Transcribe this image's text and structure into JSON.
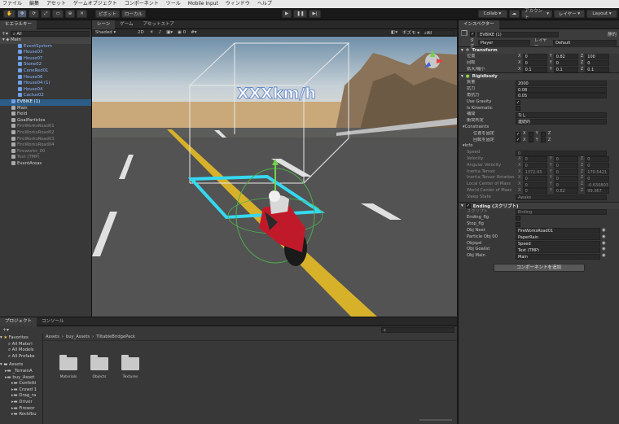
{
  "menubar": [
    "ファイル",
    "編集",
    "アセット",
    "ゲームオブジェクト",
    "コンポーネント",
    "ツール",
    "Mobile Input",
    "ウィンドウ",
    "ヘルプ"
  ],
  "toolbar": {
    "pivot": "ピボット",
    "local": "ローカル",
    "collab": "Collab",
    "account": "アカウント",
    "layers": "レイヤー",
    "layout": "Layout"
  },
  "hierarchy": {
    "tab": "ヒエラルキー",
    "search": "All",
    "root": "Main",
    "items": [
      {
        "label": "EventSystem",
        "style": "blue"
      },
      {
        "label": "House03",
        "style": "blue"
      },
      {
        "label": "House07",
        "style": "blue"
      },
      {
        "label": "Stone02",
        "style": "blue"
      },
      {
        "label": "ConeRed01",
        "style": "blue"
      },
      {
        "label": "House06",
        "style": "blue"
      },
      {
        "label": "House04 (1)",
        "style": "blue"
      },
      {
        "label": "House04",
        "style": "blue"
      },
      {
        "label": "Cactus02",
        "style": "blue"
      },
      {
        "label": "EVBIKE (1)",
        "style": "sel"
      },
      {
        "label": "Main",
        "style": ""
      },
      {
        "label": "Field",
        "style": ""
      },
      {
        "label": "GoalParticles",
        "style": ""
      },
      {
        "label": "FireWorksRoad01",
        "style": "dim"
      },
      {
        "label": "FireWorksRoad02",
        "style": "dim"
      },
      {
        "label": "FireWorksRoad03",
        "style": "dim"
      },
      {
        "label": "FireWorksRoad04",
        "style": "dim"
      },
      {
        "label": "Fireworks_00",
        "style": "dim"
      },
      {
        "label": "Text (TMP)",
        "style": "dim"
      },
      {
        "label": "EventAreas",
        "style": ""
      }
    ]
  },
  "scene": {
    "tabs": [
      "シーン",
      "ゲーム",
      "アセットストア"
    ],
    "shading": "Shaded",
    "mode2d": "2D",
    "gizmos": "ギズモ",
    "search": "All",
    "persp_label": "XXXkm/h"
  },
  "inspector": {
    "tab": "インスペクター",
    "object_name": "EVBIKE (1)",
    "static": "静的",
    "tag_label": "タグ",
    "tag_value": "Player",
    "layer_label": "レイヤー",
    "layer_value": "Default",
    "transform": {
      "title": "Transform",
      "rows": [
        {
          "label": "位置",
          "x": "0",
          "y": "0.82",
          "z": "100"
        },
        {
          "label": "回転",
          "x": "0",
          "y": "0",
          "z": "0"
        },
        {
          "label": "拡大/縮小",
          "x": "0.1",
          "y": "0.1",
          "z": "0.1"
        }
      ]
    },
    "rigidbody": {
      "title": "Rigidbody",
      "rows": [
        {
          "label": "質量",
          "value": "2000"
        },
        {
          "label": "抗力",
          "value": "0.08"
        },
        {
          "label": "角抗力",
          "value": "0.05"
        }
      ],
      "use_gravity": "Use Gravity",
      "is_kinematic": "Is Kinematic",
      "interpolate_label": "補間",
      "interpolate_value": "なし",
      "collision_label": "衝突判定",
      "collision_value": "連続的",
      "constraints": "Constraints",
      "freeze_pos": "位置を固定",
      "freeze_rot": "回転を固定",
      "xyz": [
        "X",
        "Y",
        "Z"
      ],
      "info": "Info",
      "info_rows": [
        {
          "label": "Speed",
          "values": [
            "0"
          ]
        },
        {
          "label": "Velocity",
          "values": [
            "0",
            "0",
            "0"
          ]
        },
        {
          "label": "Angular Velocity",
          "values": [
            "0",
            "0",
            "0"
          ]
        },
        {
          "label": "Inertia Tensor",
          "values": [
            "1372.43",
            "0",
            "170.5421"
          ]
        },
        {
          "label": "Inertia Tensor Rotation",
          "values": [
            "0",
            "0",
            "0"
          ]
        },
        {
          "label": "Local Center of Mass",
          "values": [
            "0",
            "0",
            "-0.6308032"
          ]
        },
        {
          "label": "World Center of Mass",
          "values": [
            "0",
            "0.82",
            "99.367"
          ]
        },
        {
          "label": "Sleep State",
          "values": [
            "Awake"
          ]
        }
      ]
    },
    "ending": {
      "title": "Ending (スクリプト)",
      "script_label": "スクリプト",
      "script_value": "Ending",
      "flags": [
        {
          "label": "Ending_flg"
        },
        {
          "label": "Stop_flg"
        }
      ],
      "refs": [
        {
          "label": "Obj Next",
          "value": "FireWorksRoad01"
        },
        {
          "label": "Particle Obj 00",
          "value": "PaperRain"
        },
        {
          "label": "Objspd",
          "value": "Speed"
        },
        {
          "label": "Obj Goalist",
          "value": "Text (TMP)"
        },
        {
          "label": "Obj Main",
          "value": "Main"
        }
      ]
    },
    "add_component": "コンポーネントを追加"
  },
  "project": {
    "tabs": [
      "プロジェクト",
      "コンソール"
    ],
    "favorites": "Favorites",
    "fav_items": [
      "All Materi",
      "All Models",
      "All Prefabs"
    ],
    "assets": "Assets",
    "asset_items": [
      "_TerrainA",
      "buy_Asset",
      "Confetti",
      "Crowd 1",
      "Drag_ra",
      "Driver",
      "Firewor",
      "Rockfbu"
    ],
    "breadcrumb": [
      "Assets",
      "buy_Assets",
      "TiltableBridgePack"
    ],
    "folders": [
      "Materials",
      "Objects",
      "Textures"
    ]
  }
}
